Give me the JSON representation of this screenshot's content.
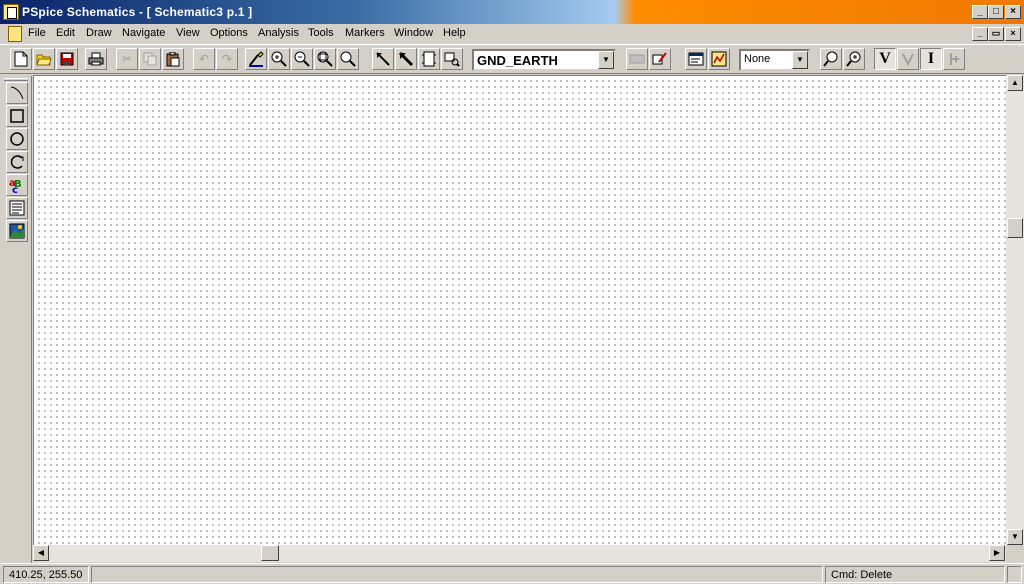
{
  "window": {
    "title": "PSpice Schematics - [ Schematic3  p.1   ]",
    "caption_buttons": [
      "_",
      "□",
      "×"
    ]
  },
  "menu": {
    "items": [
      "File",
      "Edit",
      "Draw",
      "Navigate",
      "View",
      "Options",
      "Analysis",
      "Tools",
      "Markers",
      "Window",
      "Help"
    ],
    "mdi_buttons": [
      "_",
      "▭",
      "×"
    ]
  },
  "toolbar": {
    "part_combo_value": "GND_EARTH",
    "zoom_combo_value": "None",
    "marker_voltage_label": "V",
    "marker_current_label": "I"
  },
  "status": {
    "coordinates": "410.25, 255.50",
    "command": "Cmd: Delete"
  },
  "colors": {
    "title_gradient_start": "#0a246a",
    "title_gradient_end": "#f07800",
    "face": "#d4d0c8",
    "canvas": "#ffffff"
  }
}
